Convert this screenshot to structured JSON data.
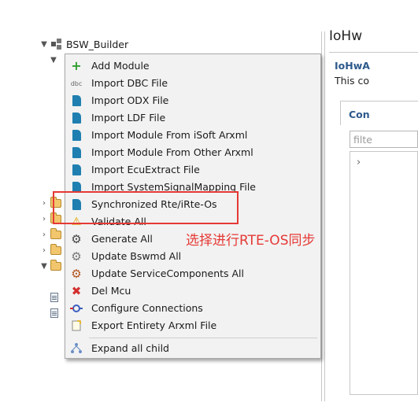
{
  "tree": {
    "root_label": "BSW_Builder"
  },
  "right_panel": {
    "title": "IoHw",
    "subtitle": "IoHwA",
    "description": "This co",
    "tab": "Con",
    "filter_placeholder": "filte"
  },
  "menu": {
    "items": [
      {
        "label": "Add Module",
        "icon": "add-icon"
      },
      {
        "label": "Import DBC File",
        "icon": "dbc-icon"
      },
      {
        "label": "Import ODX File",
        "icon": "import-icon"
      },
      {
        "label": "Import LDF File",
        "icon": "import-icon"
      },
      {
        "label": "Import Module From iSoft Arxml",
        "icon": "import-icon"
      },
      {
        "label": "Import Module From Other Arxml",
        "icon": "import-icon"
      },
      {
        "label": "Import EcuExtract File",
        "icon": "import-icon"
      },
      {
        "label": "Import SystemSignalMapping File",
        "icon": "import-icon"
      },
      {
        "label": "Synchronized Rte/iRte-Os",
        "icon": "sync-icon"
      },
      {
        "label": "Validate All",
        "icon": "warning-icon"
      },
      {
        "label": "Generate All",
        "icon": "gear-icon"
      },
      {
        "label": "Update Bswmd All",
        "icon": "update-icon"
      },
      {
        "label": "Update ServiceComponents All",
        "icon": "service-update-icon"
      },
      {
        "label": "Del Mcu",
        "icon": "delete-icon"
      },
      {
        "label": "Configure Connections",
        "icon": "connection-icon"
      },
      {
        "label": "Export Entirety Arxml File",
        "icon": "export-icon"
      }
    ],
    "last_item": {
      "label": "Expand all child",
      "icon": "expand-tree-icon"
    }
  },
  "annotation": {
    "text": "选择进行RTE-OS同步",
    "color": "#e53935"
  }
}
